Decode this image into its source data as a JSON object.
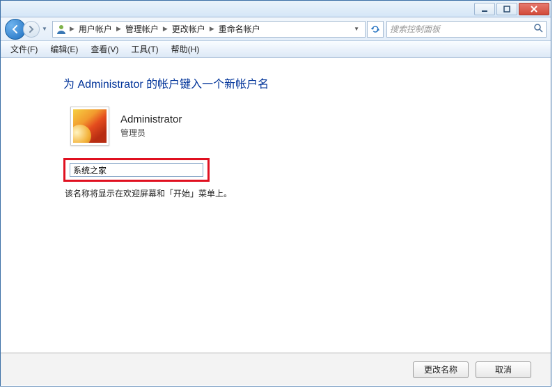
{
  "window_controls": {
    "min_title": "最小化",
    "max_title": "最大化",
    "close_title": "关闭"
  },
  "breadcrumb": {
    "items": [
      "用户帐户",
      "管理帐户",
      "更改帐户",
      "重命名帐户"
    ]
  },
  "search": {
    "placeholder": "搜索控制面板"
  },
  "menu": {
    "file": "文件(F)",
    "edit": "编辑(E)",
    "view": "查看(V)",
    "tools": "工具(T)",
    "help": "帮助(H)"
  },
  "page": {
    "title": "为 Administrator 的帐户键入一个新帐户名",
    "account_name": "Administrator",
    "account_role": "管理员",
    "input_value": "系统之家",
    "hint": "该名称将显示在欢迎屏幕和「开始」菜单上。"
  },
  "buttons": {
    "rename": "更改名称",
    "cancel": "取消"
  }
}
